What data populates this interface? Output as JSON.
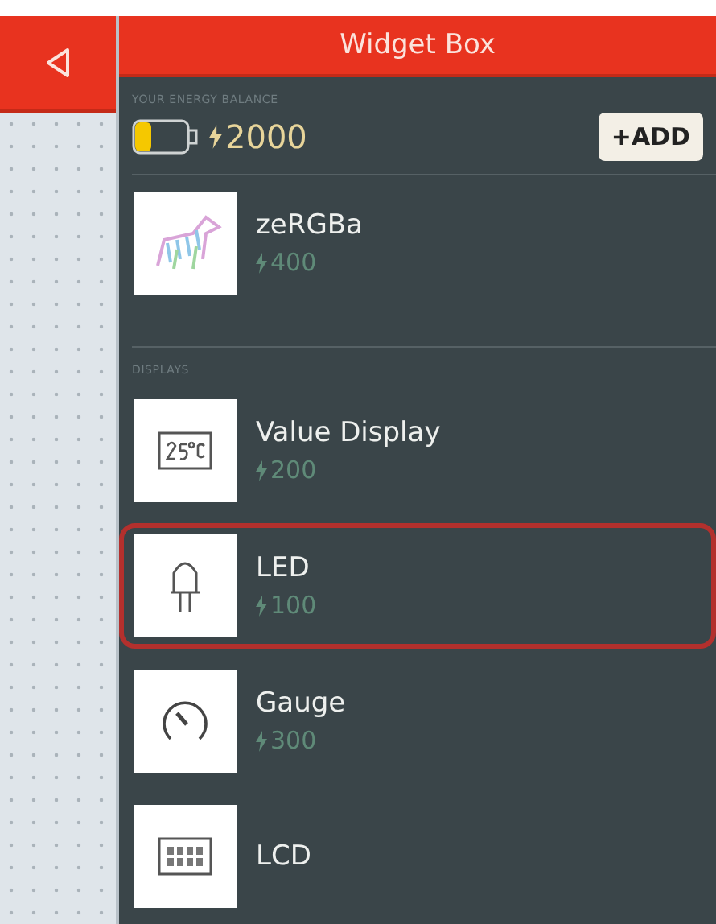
{
  "header": {
    "title": "Widget Box"
  },
  "balance": {
    "label": "YOUR ENERGY BALANCE",
    "amount": "2000",
    "add_button": "+ADD"
  },
  "sections": [
    {
      "items": [
        {
          "kind": "zergba",
          "name": "zeRGBa",
          "price": "400",
          "selected": false
        }
      ]
    },
    {
      "title": "DISPLAYS",
      "items": [
        {
          "kind": "value",
          "name": "Value Display",
          "price": "200",
          "selected": false
        },
        {
          "kind": "led",
          "name": "LED",
          "price": "100",
          "selected": true
        },
        {
          "kind": "gauge",
          "name": "Gauge",
          "price": "300",
          "selected": false
        },
        {
          "kind": "lcd",
          "name": "LCD",
          "selected": false
        }
      ]
    }
  ]
}
